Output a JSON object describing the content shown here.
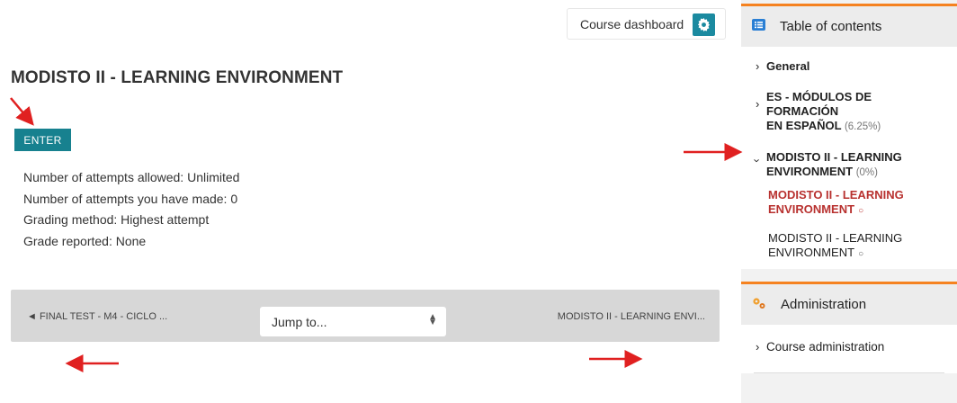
{
  "header": {
    "course_dashboard_label": "Course dashboard"
  },
  "activity": {
    "title": "MODISTO II - LEARNING ENVIRONMENT",
    "enter_label": "ENTER",
    "info": [
      "Number of attempts allowed: Unlimited",
      "Number of attempts you have made: 0",
      "Grading method: Highest attempt",
      "Grade reported: None"
    ]
  },
  "navigation": {
    "prev_label": "◄ FINAL TEST - M4 - CICLO ...",
    "jump_placeholder": "Jump to...",
    "next_label": "MODISTO II - LEARNING ENVI..."
  },
  "sidebar": {
    "toc": {
      "title": "Table of contents",
      "items": [
        {
          "label": "General"
        },
        {
          "label_line1": "ES - MÓDULOS DE FORMACIÓN",
          "label_line2": "EN ESPAÑOL",
          "progress": "(6.25%)"
        },
        {
          "label_line1": "MODISTO II - LEARNING",
          "label_line2": "ENVIRONMENT",
          "progress": "(0%)",
          "children": [
            {
              "line1": "MODISTO II - LEARNING",
              "line2": "ENVIRONMENT"
            },
            {
              "line1": "MODISTO II - LEARNING",
              "line2": "ENVIRONMENT"
            }
          ]
        }
      ]
    },
    "administration": {
      "title": "Administration",
      "items": [
        {
          "label": "Course administration"
        }
      ]
    }
  },
  "colors": {
    "accent_teal": "#17818f",
    "active_red": "#b8312f",
    "block_orange": "#f58220",
    "annotation_red": "#e02020"
  }
}
